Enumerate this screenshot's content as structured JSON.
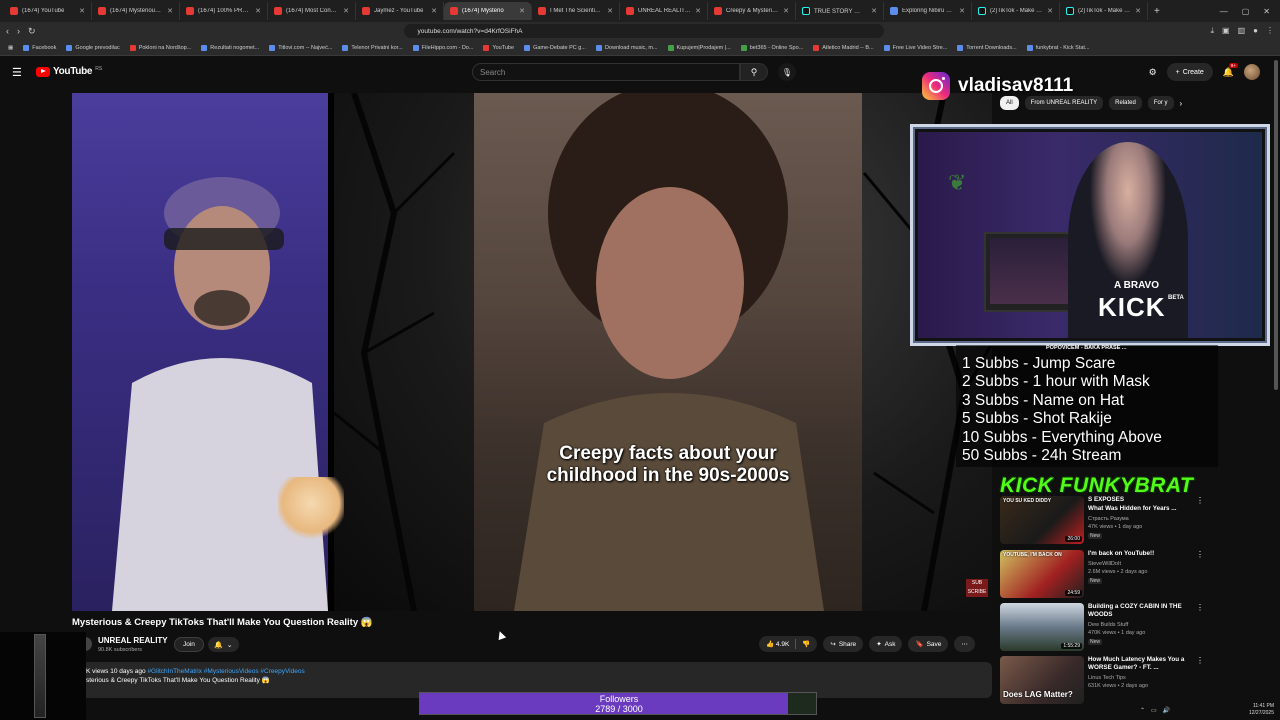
{
  "browser": {
    "tabs": [
      {
        "title": "(1674) YouTube",
        "icon": "youtube-icon"
      },
      {
        "title": "(1674) Mysterious Video",
        "icon": "youtube-icon"
      },
      {
        "title": "(1674) 100% PROOF, FA",
        "icon": "youtube-icon"
      },
      {
        "title": "(1674) Most Convincing",
        "icon": "youtube-icon"
      },
      {
        "title": "Jaymez - YouTube",
        "icon": "youtube-icon"
      },
      {
        "title": "(1674) Mysterio",
        "icon": "youtube-icon",
        "active": true
      },
      {
        "title": "I Met The Scientist That",
        "icon": "youtube-icon"
      },
      {
        "title": "UNREAL REALITY - YouT",
        "icon": "youtube-icon"
      },
      {
        "title": "Creepy & Mysterious Vi",
        "icon": "youtube-icon"
      },
      {
        "title": "TRUE STORY 🥶 #randi",
        "icon": "tiktok-icon"
      },
      {
        "title": "Exploring Nibiru and the",
        "icon": "web-icon"
      },
      {
        "title": "(2)TikTok - Make Your D",
        "icon": "tiktok-icon"
      },
      {
        "title": "(2)TikTok - Make Your D",
        "icon": "tiktok-icon"
      }
    ],
    "url": "youtube.com/watch?v=d4KrfOSiFhA",
    "bookmarks": [
      {
        "label": "Facebook",
        "color": "blue"
      },
      {
        "label": "Google prevodilac",
        "color": "blue"
      },
      {
        "label": "Pokloni na Nordšop...",
        "color": "red"
      },
      {
        "label": "Rezultati nogomet...",
        "color": "blue"
      },
      {
        "label": "Titlovi.com -- Najveć...",
        "color": "blue"
      },
      {
        "label": "Telenor Privatni kor...",
        "color": "blue"
      },
      {
        "label": "FileHippo.com - Do...",
        "color": "blue"
      },
      {
        "label": "YouTube",
        "color": "red"
      },
      {
        "label": "Game-Debate PC g...",
        "color": "blue"
      },
      {
        "label": "Download music, m...",
        "color": "blue"
      },
      {
        "label": "Kupujem|Prodajem |...",
        "color": "grn"
      },
      {
        "label": "bet365 - Online Spo...",
        "color": "grn"
      },
      {
        "label": "Atletico Madrid -- B...",
        "color": "red"
      },
      {
        "label": "Free Live Video Stre...",
        "color": "blue"
      },
      {
        "label": "Torrent Downloads...",
        "color": "blue"
      },
      {
        "label": "funkybrat - Kick Stat...",
        "color": "blue"
      }
    ]
  },
  "youtube": {
    "logo": "YouTube",
    "region": "RS",
    "search_placeholder": "Search",
    "create_label": "Create",
    "notif_count": "9+",
    "video": {
      "caption_line1": "Creepy facts about your",
      "caption_line2": "childhood in the 90s-2000s",
      "subs_mark": "SUB SCRIBE",
      "title": "Mysterious & Creepy TikToks That'll Make You Question Reality 😱",
      "channel": "UNREAL REALITY",
      "subscribers": "90.8K subscribers",
      "join_label": "Join",
      "likes": "4.9K",
      "share_label": "Share",
      "ask_label": "Ask",
      "save_label": "Save",
      "desc_stats": "K views  10 days ago",
      "desc_tags": "#GlitchInTheMatrix #MysteriousVideos #CreepyVideos",
      "desc_text": "sterious & Creepy TikToks That'll Make You Question Reality 😱"
    },
    "chips": [
      "All",
      "From UNREAL REALITY",
      "Related",
      "For y"
    ],
    "recommendations": [
      {
        "title": "What Was Hidden for Years ...",
        "title_prefix": "S EXPOSES",
        "channel": "Страсть Разума",
        "views": "47K views • 1 day ago",
        "duration": "26:00",
        "new": "New",
        "thumb_text": "YOU SU KED DIDDY"
      },
      {
        "title": "I'm back on YouTube!!",
        "channel": "SteveWillDoIt",
        "views": "2.6M views • 2 days ago",
        "duration": "24:59",
        "new": "New",
        "thumb_text": "YOUTUBE, I'M BACK ON"
      },
      {
        "title": "Building a COZY CABIN IN THE WOODS",
        "channel": "Dew Builds Stuff",
        "views": "470K views • 1 day ago",
        "duration": "1:55:29",
        "new": "New"
      },
      {
        "title": "How Much Latency Makes You a WORSE Gamer? - FT. ...",
        "channel": "Linus Tech Tips",
        "views": "631K views • 2 days ago",
        "duration": "",
        "thumb_text": "Does LAG Matter?"
      }
    ]
  },
  "overlay": {
    "instagram_handle": "vladisav8111",
    "goals_header": "POPOVIĆEM - BAKA PRASE ...",
    "goals": [
      "1 Subbs - Jump Scare",
      "2 Subbs - 1 hour with Mask",
      "3 Subbs - Name on Hat",
      "5 Subbs - Shot Rakije",
      "10 Subbs - Everything Above",
      "50 Subbs - 24h Stream"
    ],
    "kick_name": "KICK FUNKYBRAT",
    "webcam_shirt_top": "A BRAVO",
    "webcam_shirt_main": "KICK",
    "webcam_shirt_beta": "BETA",
    "followers_label": "Followers",
    "followers_count": "2789 / 3000",
    "followers_current": 2789,
    "followers_goal": 3000
  },
  "taskbar": {
    "time": "11:41 PM",
    "date": "12/27/2025"
  }
}
